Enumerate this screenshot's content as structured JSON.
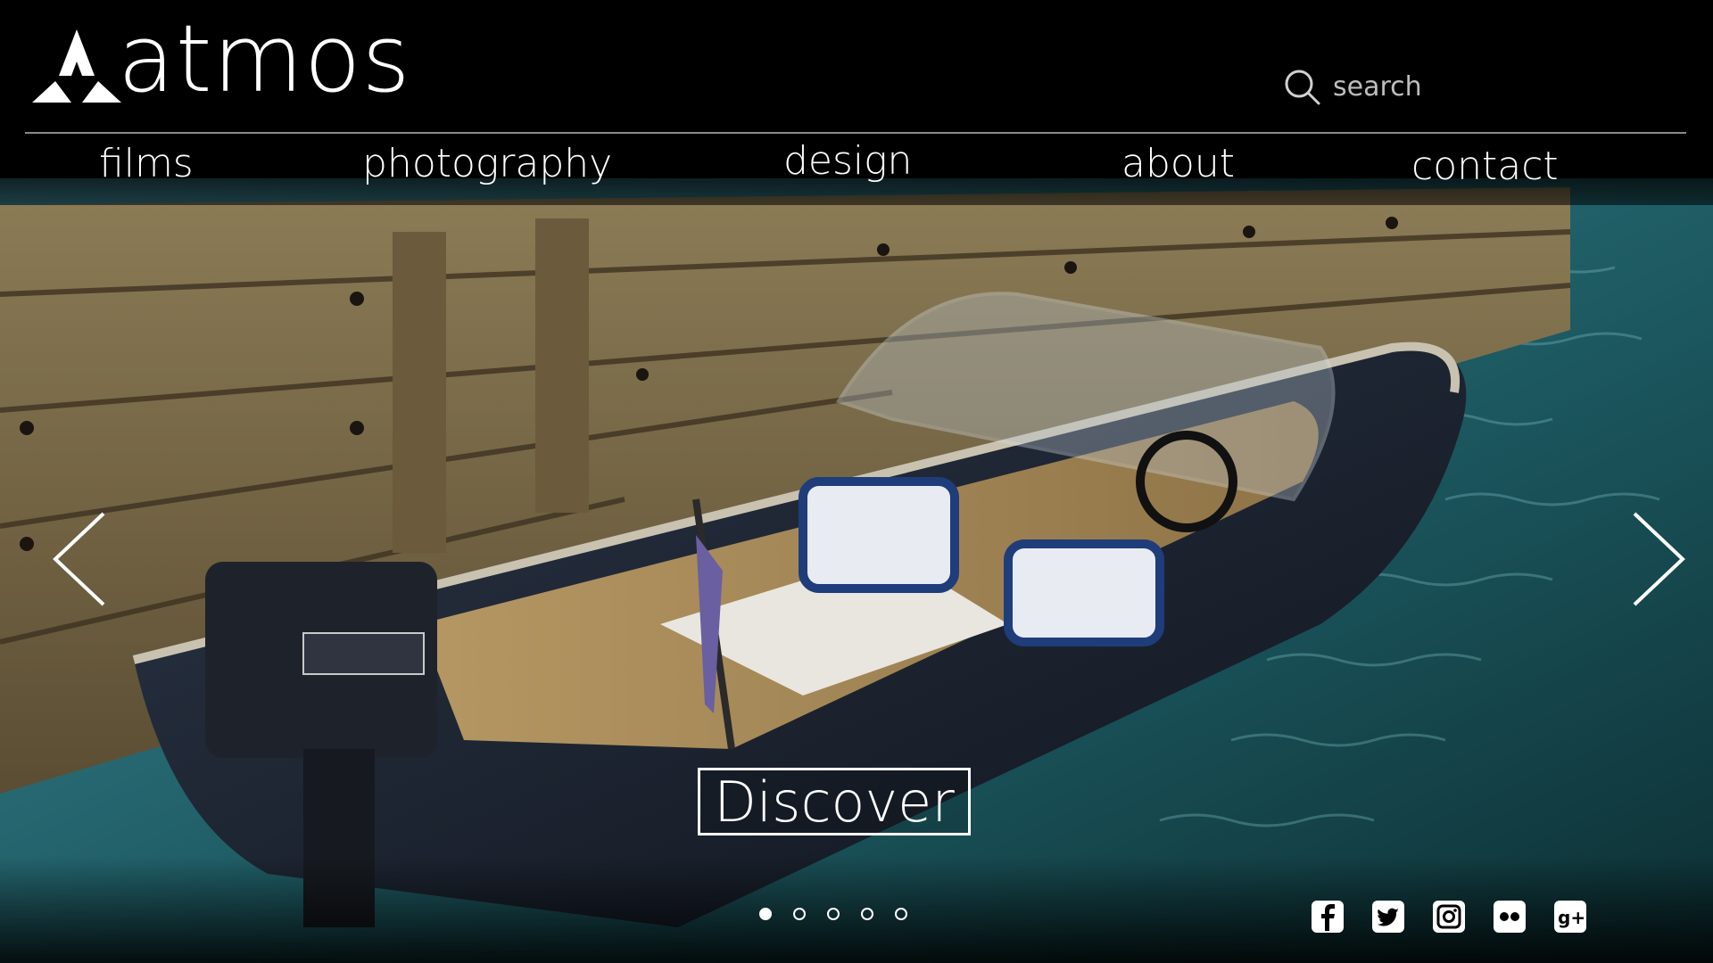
{
  "brand": {
    "name": "atmos"
  },
  "search": {
    "placeholder": "search"
  },
  "nav": {
    "items": [
      {
        "label": "films"
      },
      {
        "label": "photography"
      },
      {
        "label": "design"
      },
      {
        "label": "about"
      },
      {
        "label": "contact"
      }
    ]
  },
  "hero": {
    "cta_label": "Discover",
    "slide_count": 5,
    "active_slide": 1,
    "prev_icon": "chevron-left-icon",
    "next_icon": "chevron-right-icon"
  },
  "social": {
    "icons": [
      "facebook-icon",
      "twitter-icon",
      "instagram-icon",
      "flickr-icon",
      "google-plus-icon"
    ]
  },
  "colors": {
    "background": "#000000",
    "text": "#ffffff",
    "divider": "#8a8a8a",
    "water": "#1f5d66",
    "dock_wood": "#7a6a48",
    "boat_hull": "#1d2533"
  }
}
